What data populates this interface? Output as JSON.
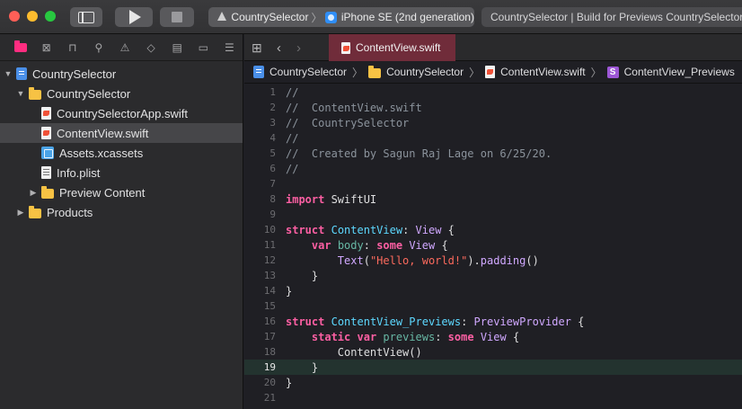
{
  "toolbar": {
    "scheme_name": "CountrySelector",
    "device_name": "iPhone SE (2nd generation)",
    "activity_text": "CountrySelector | Build for Previews CountrySelector: Succeeded"
  },
  "navigator": {
    "tabs": [
      "project-navigator",
      "source-control",
      "symbol-navigator",
      "find",
      "issues",
      "tests",
      "debug",
      "breakpoints",
      "reports"
    ],
    "tree": [
      {
        "label": "CountrySelector",
        "depth": 0,
        "kind": "project",
        "expanded": true,
        "selected": false
      },
      {
        "label": "CountrySelector",
        "depth": 1,
        "kind": "folder",
        "expanded": true,
        "selected": false
      },
      {
        "label": "CountrySelectorApp.swift",
        "depth": 2,
        "kind": "swift",
        "selected": false
      },
      {
        "label": "ContentView.swift",
        "depth": 2,
        "kind": "swift",
        "selected": true
      },
      {
        "label": "Assets.xcassets",
        "depth": 2,
        "kind": "assets",
        "selected": false
      },
      {
        "label": "Info.plist",
        "depth": 2,
        "kind": "plist",
        "selected": false
      },
      {
        "label": "Preview Content",
        "depth": 2,
        "kind": "folder",
        "expanded": false,
        "selected": false
      },
      {
        "label": "Products",
        "depth": 1,
        "kind": "folder",
        "expanded": false,
        "selected": false
      }
    ]
  },
  "editor": {
    "active_tab": "ContentView.swift",
    "breadcrumb": [
      "CountrySelector",
      "CountrySelector",
      "ContentView.swift",
      "ContentView_Previews"
    ],
    "current_line": 19,
    "lines": [
      [
        {
          "t": "//",
          "c": "comment"
        }
      ],
      [
        {
          "t": "//  ContentView.swift",
          "c": "comment"
        }
      ],
      [
        {
          "t": "//  CountrySelector",
          "c": "comment"
        }
      ],
      [
        {
          "t": "//",
          "c": "comment"
        }
      ],
      [
        {
          "t": "//  Created by Sagun Raj Lage on 6/25/20.",
          "c": "comment"
        }
      ],
      [
        {
          "t": "//",
          "c": "comment"
        }
      ],
      [],
      [
        {
          "t": "import",
          "c": "keyword"
        },
        {
          "t": " SwiftUI",
          "c": "plain"
        }
      ],
      [],
      [
        {
          "t": "struct",
          "c": "keyword"
        },
        {
          "t": " ",
          "c": "plain"
        },
        {
          "t": "ContentView",
          "c": "type"
        },
        {
          "t": ": ",
          "c": "plain"
        },
        {
          "t": "View",
          "c": "systype"
        },
        {
          "t": " {",
          "c": "plain"
        }
      ],
      [
        {
          "t": "    ",
          "c": "plain"
        },
        {
          "t": "var",
          "c": "keyword"
        },
        {
          "t": " ",
          "c": "plain"
        },
        {
          "t": "body",
          "c": "ident"
        },
        {
          "t": ": ",
          "c": "plain"
        },
        {
          "t": "some",
          "c": "keyword"
        },
        {
          "t": " ",
          "c": "plain"
        },
        {
          "t": "View",
          "c": "systype"
        },
        {
          "t": " {",
          "c": "plain"
        }
      ],
      [
        {
          "t": "        ",
          "c": "plain"
        },
        {
          "t": "Text",
          "c": "systype"
        },
        {
          "t": "(",
          "c": "plain"
        },
        {
          "t": "\"Hello, world!\"",
          "c": "string"
        },
        {
          "t": ").",
          "c": "plain"
        },
        {
          "t": "padding",
          "c": "systype"
        },
        {
          "t": "()",
          "c": "plain"
        }
      ],
      [
        {
          "t": "    }",
          "c": "plain"
        }
      ],
      [
        {
          "t": "}",
          "c": "plain"
        }
      ],
      [],
      [
        {
          "t": "struct",
          "c": "keyword"
        },
        {
          "t": " ",
          "c": "plain"
        },
        {
          "t": "ContentView_Previews",
          "c": "type"
        },
        {
          "t": ": ",
          "c": "plain"
        },
        {
          "t": "PreviewProvider",
          "c": "systype"
        },
        {
          "t": " {",
          "c": "plain"
        }
      ],
      [
        {
          "t": "    ",
          "c": "plain"
        },
        {
          "t": "static",
          "c": "keyword"
        },
        {
          "t": " ",
          "c": "plain"
        },
        {
          "t": "var",
          "c": "keyword"
        },
        {
          "t": " ",
          "c": "plain"
        },
        {
          "t": "previews",
          "c": "ident"
        },
        {
          "t": ": ",
          "c": "plain"
        },
        {
          "t": "some",
          "c": "keyword"
        },
        {
          "t": " ",
          "c": "plain"
        },
        {
          "t": "View",
          "c": "systype"
        },
        {
          "t": " {",
          "c": "plain"
        }
      ],
      [
        {
          "t": "        ",
          "c": "plain"
        },
        {
          "t": "ContentView",
          "c": "plain"
        },
        {
          "t": "()",
          "c": "plain"
        }
      ],
      [
        {
          "t": "    }",
          "c": "plain"
        }
      ],
      [
        {
          "t": "}",
          "c": "plain"
        }
      ],
      []
    ]
  }
}
